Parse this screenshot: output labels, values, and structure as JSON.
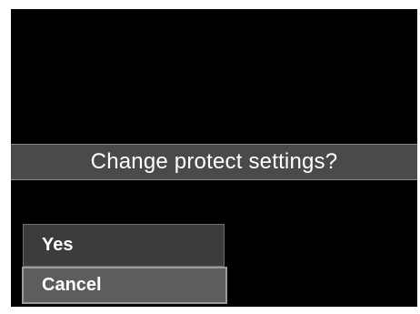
{
  "dialog": {
    "prompt": "Change protect settings?",
    "options": [
      {
        "label": "Yes",
        "selected": false
      },
      {
        "label": "Cancel",
        "selected": true
      }
    ]
  },
  "colors": {
    "screen_bg": "#000000",
    "bar_bg": "#4a4a4a",
    "option_bg": "#3c3c3c",
    "selected_bg": "#5d5d5d",
    "text": "#ffffff"
  }
}
